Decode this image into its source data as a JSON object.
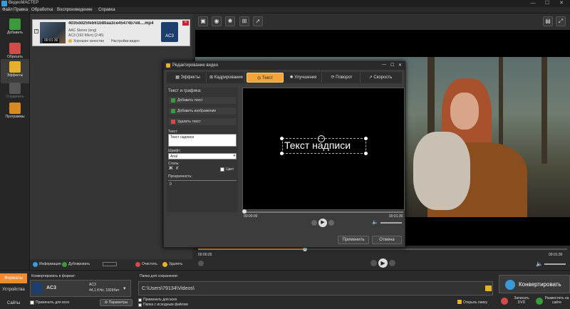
{
  "app": {
    "title": "ВидеоМАСТЕР"
  },
  "menu": [
    "Файл",
    "Правка",
    "Обработка",
    "Воспроизведение",
    "Справка"
  ],
  "sidebar": [
    {
      "label": "Добавить",
      "icon": "add-icon",
      "color": "#3c9a3c"
    },
    {
      "label": "Обрезать",
      "icon": "scissors-icon",
      "color": "#d34a4a"
    },
    {
      "label": "Эффекты",
      "icon": "effects-icon",
      "color": "#e6b12a"
    },
    {
      "label": "Соединить",
      "icon": "join-icon",
      "color": "#666666"
    },
    {
      "label": "Программы",
      "icon": "programs-icon",
      "color": "#d98a1e"
    }
  ],
  "file": {
    "name": "4035dd25feb61b80aa3ce45474b7e8....mp4",
    "duration": "00:01:30",
    "audio": "AAC Stereo (eng)",
    "audio2": "AC3 (192 Кбит) (2:46)",
    "quality": "Хорошее качество",
    "settings": "Настройки видео",
    "format": "AC3"
  },
  "dialog": {
    "title": "Редактирование видео",
    "tabs": [
      "Эффекты",
      "Кадрирование",
      "Текст",
      "Улучшения",
      "Поворот",
      "Скорость"
    ],
    "active_tab": "Текст",
    "section": "Текст и графика:",
    "add_text": "Добавить текст",
    "add_image": "Добавить изображение",
    "delete_text": "Удалить текст",
    "text_label": "Текст:",
    "text_value": "Текст надписи",
    "font_label": "Шрифт:",
    "font_value": "Arial",
    "style_label": "Стиль:",
    "color_label": "Цвет",
    "opacity_label": "Прозрачность:",
    "opacity_value": "0",
    "overlay_text": "Текст надписи",
    "time_start": "00:00:00",
    "time_end": "00:01:30",
    "apply": "Применить",
    "cancel": "Отмена"
  },
  "timeline": {
    "start": "00:00:26",
    "end": "00:01:30",
    "progress": 0.29
  },
  "listbar": {
    "info": "Информация",
    "duplicate": "Дублировать",
    "clear": "Очистить",
    "delete": "Удалить"
  },
  "bottom": {
    "formats_tab": "Форматы",
    "devices_tab": "Устройства",
    "sites_tab": "Сайты",
    "convert_label": "Конвертировать в формат:",
    "format_name": "AC3",
    "format_sub": "AC3",
    "format_info": "44,1 KHz, 192Кбит",
    "apply_all": "Применить для всех",
    "params": "Параметры",
    "folder_label": "Папка для сохранения:",
    "folder_path": "C:\\Users\\79134\\Videos\\",
    "apply_all2": "Применить для всех",
    "source_folder": "Папка с исходным файлом",
    "open_folder": "Открыть папку",
    "convert_btn": "Конвертировать",
    "dvd": "Записать DVD",
    "publish": "Разместить на сайте"
  }
}
